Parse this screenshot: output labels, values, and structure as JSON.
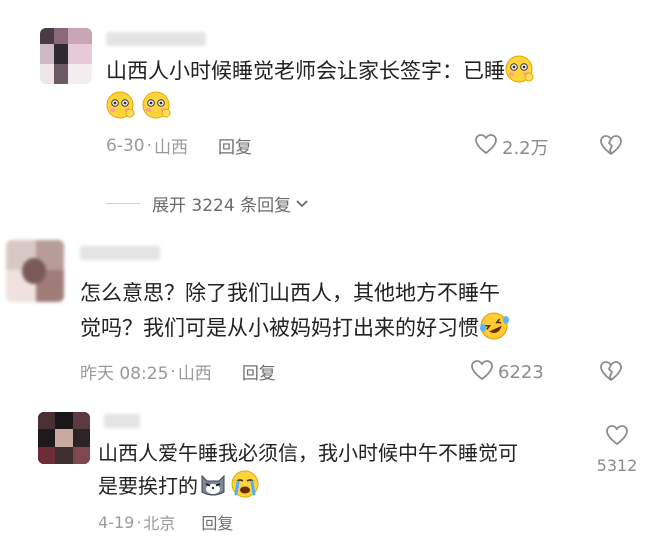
{
  "comments": [
    {
      "text_line1": "山西人小时候睡觉老师会让家长签字：已睡",
      "text_line2": "",
      "date": "6-30",
      "location": "山西",
      "reply_label": "回复",
      "like_count": "2.2万",
      "emoji_line1_end": [
        "shy-face"
      ],
      "emoji_line2": [
        "shy-face",
        "shy-face"
      ]
    },
    {
      "text_line1": "怎么意思？除了我们山西人，其他地方不睡午",
      "text_line2": "觉吗？我们可是从小被妈妈打出来的好习惯",
      "date": "昨天 08:25",
      "location": "山西",
      "reply_label": "回复",
      "like_count": "6223",
      "emoji_line2_end": [
        "rolling-laughing-face"
      ]
    },
    {
      "text_line1": "山西人爱午睡我必须信，我小时候中午不睡觉可",
      "text_line2": "是要挨打的",
      "date": "4-19",
      "location": "北京",
      "reply_label": "回复",
      "like_count": "5312",
      "emoji_line2_end": [
        "cat-face",
        "crying-face"
      ]
    }
  ],
  "expand_replies": {
    "label": "展开 3224 条回复"
  },
  "colors": {
    "text": "#222222",
    "meta": "#9a9a9a",
    "background": "#ffffff"
  }
}
